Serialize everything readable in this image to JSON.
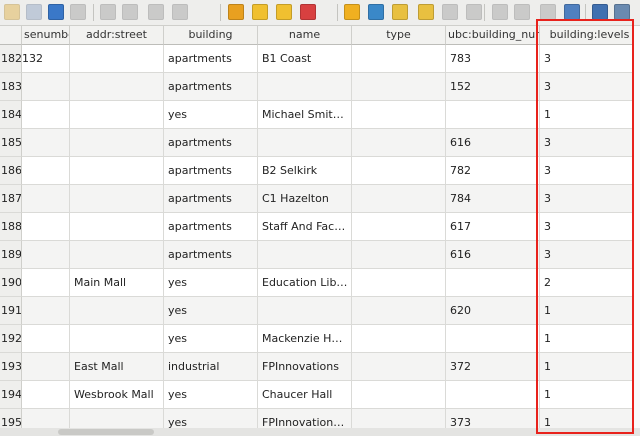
{
  "toolbar": {
    "icons": [
      {
        "name": "toggle-editing-icon",
        "color": "#e0b040",
        "disabled": true
      },
      {
        "name": "save-edits-icon",
        "color": "#8aa0c0",
        "disabled": true
      },
      {
        "name": "reload-icon",
        "color": "#3a78c8",
        "disabled": false
      },
      {
        "name": "add-feature-icon",
        "color": "#a0a0a0",
        "disabled": true
      },
      {
        "name": "delete-feature-icon",
        "color": "#a0a0a0",
        "disabled": true
      },
      {
        "name": "cut-icon",
        "color": "#a0a0a0",
        "disabled": true
      },
      {
        "name": "copy-icon",
        "color": "#a0a0a0",
        "disabled": true
      },
      {
        "name": "paste-icon",
        "color": "#a0a0a0",
        "disabled": true
      },
      {
        "name": "expression-select-icon",
        "color": "#e8a020",
        "disabled": false
      },
      {
        "name": "select-all-icon",
        "color": "#f0c030",
        "disabled": false
      },
      {
        "name": "invert-selection-icon",
        "color": "#f0c030",
        "disabled": false
      },
      {
        "name": "deselect-all-icon",
        "color": "#d84040",
        "disabled": false
      },
      {
        "name": "filter-select-icon",
        "color": "#f0b020",
        "disabled": false
      },
      {
        "name": "move-selection-top-icon",
        "color": "#3a88c8",
        "disabled": false
      },
      {
        "name": "pan-to-selection-icon",
        "color": "#e8c040",
        "disabled": false
      },
      {
        "name": "zoom-to-selection-icon",
        "color": "#e8c040",
        "disabled": false
      },
      {
        "name": "copy-rows-icon",
        "color": "#a0a0a0",
        "disabled": true
      },
      {
        "name": "paste-rows-icon",
        "color": "#a0a0a0",
        "disabled": true
      },
      {
        "name": "new-field-icon",
        "color": "#a0a0a0",
        "disabled": true
      },
      {
        "name": "delete-field-icon",
        "color": "#a0a0a0",
        "disabled": true
      },
      {
        "name": "field-calculator-icon",
        "color": "#a0a0a0",
        "disabled": true
      },
      {
        "name": "conditional-formatting-icon",
        "color": "#5080c0",
        "disabled": false
      },
      {
        "name": "dock-table-icon",
        "color": "#4070b0",
        "disabled": false
      },
      {
        "name": "actions-icon",
        "color": "#6a8ab0",
        "disabled": false
      }
    ]
  },
  "table": {
    "columns": [
      "senumbe",
      "addr:street",
      "building",
      "name",
      "type",
      "ubc:building_num",
      "building:levels"
    ],
    "rows": [
      {
        "id": "182",
        "cells": [
          "132",
          "",
          "apartments",
          "B1 Coast",
          "",
          "783",
          "3"
        ]
      },
      {
        "id": "183",
        "cells": [
          "",
          "",
          "apartments",
          "",
          "",
          "152",
          "3"
        ]
      },
      {
        "id": "184",
        "cells": [
          "",
          "",
          "yes",
          "Michael Smit…",
          "",
          "",
          "1"
        ]
      },
      {
        "id": "185",
        "cells": [
          "",
          "",
          "apartments",
          "",
          "",
          "616",
          "3"
        ]
      },
      {
        "id": "186",
        "cells": [
          "",
          "",
          "apartments",
          "B2 Selkirk",
          "",
          "782",
          "3"
        ]
      },
      {
        "id": "187",
        "cells": [
          "",
          "",
          "apartments",
          "C1 Hazelton",
          "",
          "784",
          "3"
        ]
      },
      {
        "id": "188",
        "cells": [
          "",
          "",
          "apartments",
          "Staff And Fac…",
          "",
          "617",
          "3"
        ]
      },
      {
        "id": "189",
        "cells": [
          "",
          "",
          "apartments",
          "",
          "",
          "616",
          "3"
        ]
      },
      {
        "id": "190",
        "cells": [
          "",
          "Main Mall",
          "yes",
          "Education Lib…",
          "",
          "",
          "2"
        ]
      },
      {
        "id": "191",
        "cells": [
          "",
          "",
          "yes",
          "",
          "",
          "620",
          "1"
        ]
      },
      {
        "id": "192",
        "cells": [
          "",
          "",
          "yes",
          "Mackenzie H…",
          "",
          "",
          "1"
        ]
      },
      {
        "id": "193",
        "cells": [
          "",
          "East Mall",
          "industrial",
          "FPInnovations",
          "",
          "372",
          "1"
        ]
      },
      {
        "id": "194",
        "cells": [
          "",
          "Wesbrook Mall",
          "yes",
          "Chaucer Hall",
          "",
          "",
          "1"
        ]
      },
      {
        "id": "195",
        "cells": [
          "",
          "",
          "yes",
          "FPInnovation…",
          "",
          "373",
          "1"
        ]
      }
    ]
  },
  "highlight": {
    "color": "#e8221c"
  }
}
